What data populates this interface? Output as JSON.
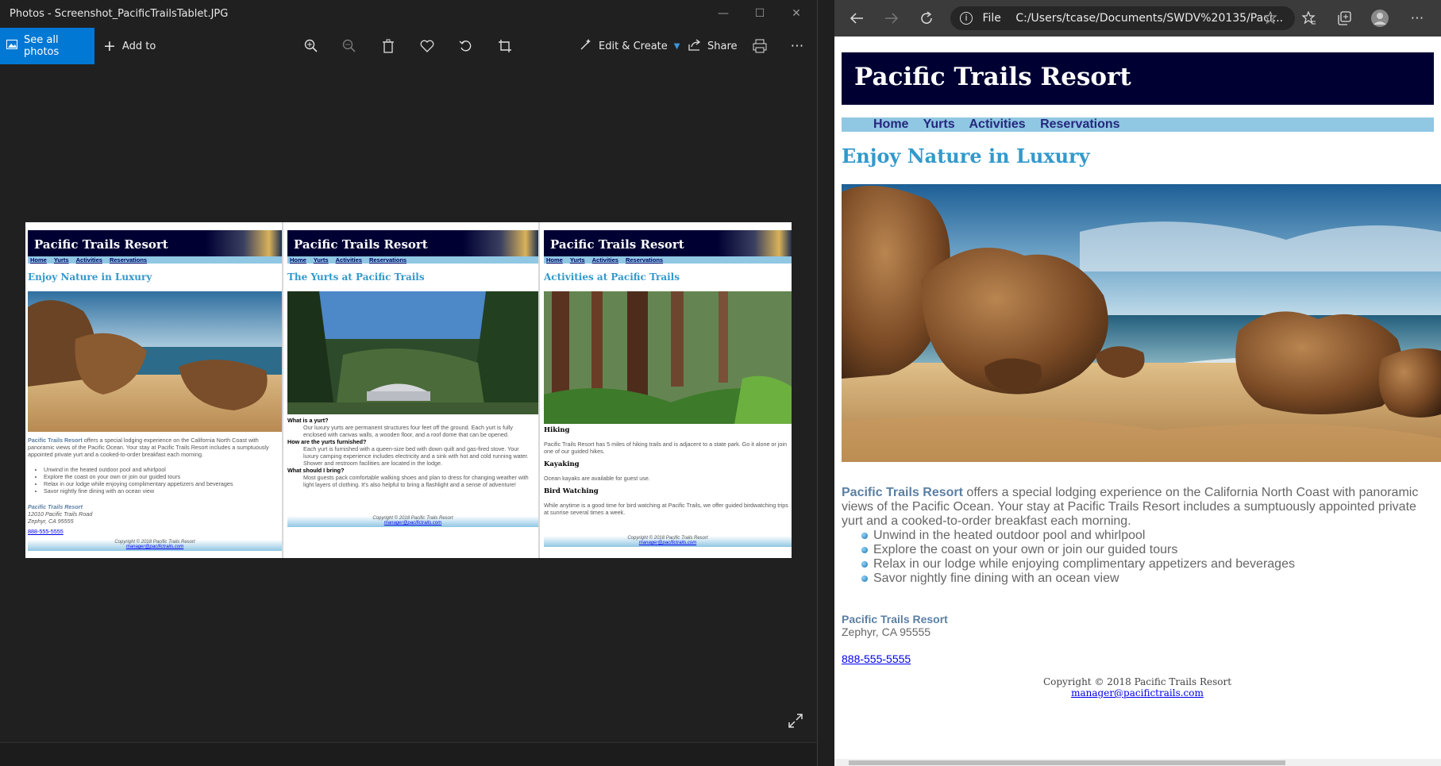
{
  "photos_app": {
    "window_title": "Photos - Screenshot_PacificTrailsTablet.JPG",
    "controls": {
      "minimize": "—",
      "maximize": "☐",
      "close": "✕"
    },
    "toolbar": {
      "see_all_photos": "See all photos",
      "add_to": "Add to",
      "edit_create": "Edit & Create",
      "share": "Share"
    },
    "icons": [
      "zoom-in-icon",
      "zoom-out-icon",
      "delete-icon",
      "favorite-icon",
      "rotate-icon",
      "crop-icon",
      "print-icon",
      "more-icon",
      "expand-icon"
    ],
    "panels": [
      {
        "site_title": "Pacific Trails Resort",
        "nav": [
          "Home",
          "Yurts",
          "Activities",
          "Reservations"
        ],
        "heading": "Enjoy Nature in Luxury",
        "intro_bold": "Pacific Trails Resort",
        "intro": "offers a special lodging experience on the California North Coast with panoramic views of the Pacific Ocean. Your stay at Pacific Trails Resort includes a sumptuously appointed private yurt and a cooked-to-order breakfast each morning.",
        "bullets": [
          "Unwind in the heated outdoor pool and whirlpool",
          "Explore the coast on your own or join our guided tours",
          "Relax in our lodge while enjoying complimentary appetizers and beverages",
          "Savor nightly fine dining with an ocean view"
        ],
        "contact_name": "Pacific Trails Resort",
        "contact_street": "12010 Pacific Trails Road",
        "contact_city": "Zephyr, CA 95555",
        "phone": "888-555-5555",
        "copyright": "Copyright © 2018 Pacific Trails Resort",
        "email": "manager@pacifictrails.com"
      },
      {
        "site_title": "Pacific Trails Resort",
        "nav": [
          "Home",
          "Yurts",
          "Activities",
          "Reservations"
        ],
        "heading": "The Yurts at Pacific Trails",
        "faq": [
          {
            "q": "What is a yurt?",
            "a": "Our luxury yurts are permanent structures four feet off the ground. Each yurt is fully enclosed with canvas walls, a wooden floor, and a roof dome that can be opened."
          },
          {
            "q": "How are the yurts furnished?",
            "a": "Each yurt is furnished with a queen-size bed with down quilt and gas-fired stove. Your luxury camping experience includes electricity and a sink with hot and cold running water. Shower and restroom facilities are located in the lodge."
          },
          {
            "q": "What should I bring?",
            "a": "Most guests pack comfortable walking shoes and plan to dress for changing weather with light layers of clothing. It's also helpful to bring a flashlight and a sense of adventure!"
          }
        ],
        "copyright": "Copyright © 2018 Pacific Trails Resort",
        "email": "manager@pacifictrails.com"
      },
      {
        "site_title": "Pacific Trails Resort",
        "nav": [
          "Home",
          "Yurts",
          "Activities",
          "Reservations"
        ],
        "heading": "Activities at Pacific Trails",
        "sections": [
          {
            "title": "Hiking",
            "text": "Pacific Trails Resort has 5 miles of hiking trails and is adjacent to a state park. Go it alone or join one of our guided hikes."
          },
          {
            "title": "Kayaking",
            "text": "Ocean kayaks are available for guest use."
          },
          {
            "title": "Bird Watching",
            "text": "While anytime is a good time for bird watching at Pacific Trails, we offer guided birdwatching trips at sunrise several times a week."
          }
        ],
        "copyright": "Copyright © 2018 Pacific Trails Resort",
        "email": "manager@pacifictrails.com"
      }
    ]
  },
  "browser": {
    "address_prefix": "File",
    "address": "C:/Users/tcase/Documents/SWDV%20135/Paci...",
    "icons": [
      "back-icon",
      "forward-icon",
      "refresh-icon",
      "info-icon",
      "add-favorite-icon",
      "favorites-icon",
      "collections-icon",
      "profile-icon",
      "more-icon"
    ]
  },
  "site": {
    "title": "Pacific Trails Resort",
    "nav": [
      "Home",
      "Yurts",
      "Activities",
      "Reservations"
    ],
    "heading": "Enjoy Nature in Luxury",
    "intro_bold": "Pacific Trails Resort",
    "intro": "offers a special lodging experience on the California North Coast with panoramic views of the Pacific Ocean. Your stay at Pacific Trails Resort includes a sumptuously appointed private yurt and a cooked-to-order breakfast each morning.",
    "bullets": [
      "Unwind in the heated outdoor pool and whirlpool",
      "Explore the coast on your own or join our guided tours",
      "Relax in our lodge while enjoying complimentary appetizers and beverages",
      "Savor nightly fine dining with an ocean view"
    ],
    "contact_name": "Pacific Trails Resort",
    "contact_city": "Zephyr, CA 95555",
    "phone": "888-555-5555",
    "copyright": "Copyright © 2018 Pacific Trails Resort",
    "email": "manager@pacifictrails.com"
  },
  "colors": {
    "header_bg": "#000033",
    "nav_bg": "#90c7e3",
    "heading": "#3399cc",
    "accent_bold": "#5c7fa3",
    "photos_accent": "#0078d4"
  }
}
